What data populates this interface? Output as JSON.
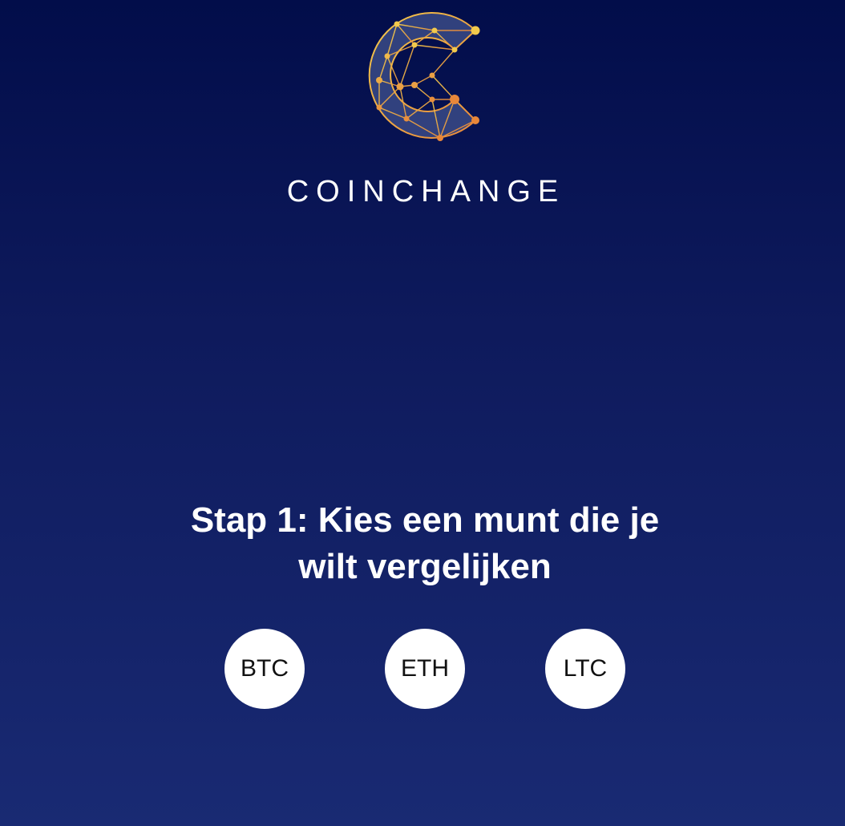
{
  "brand": {
    "name": "COINCHANGE",
    "logo_icon": "network-crescent-c-logo",
    "colors": {
      "gold": "#f2c94c",
      "orange": "#e8873a",
      "fill": "#3a4a86"
    }
  },
  "step": {
    "title": "Stap 1: Kies een munt die je wilt vergelijken"
  },
  "coins": [
    {
      "label": "BTC"
    },
    {
      "label": "ETH"
    },
    {
      "label": "LTC"
    }
  ],
  "theme": {
    "background_top": "#020d4a",
    "background_bottom": "#192a73",
    "button_bg": "#ffffff"
  }
}
